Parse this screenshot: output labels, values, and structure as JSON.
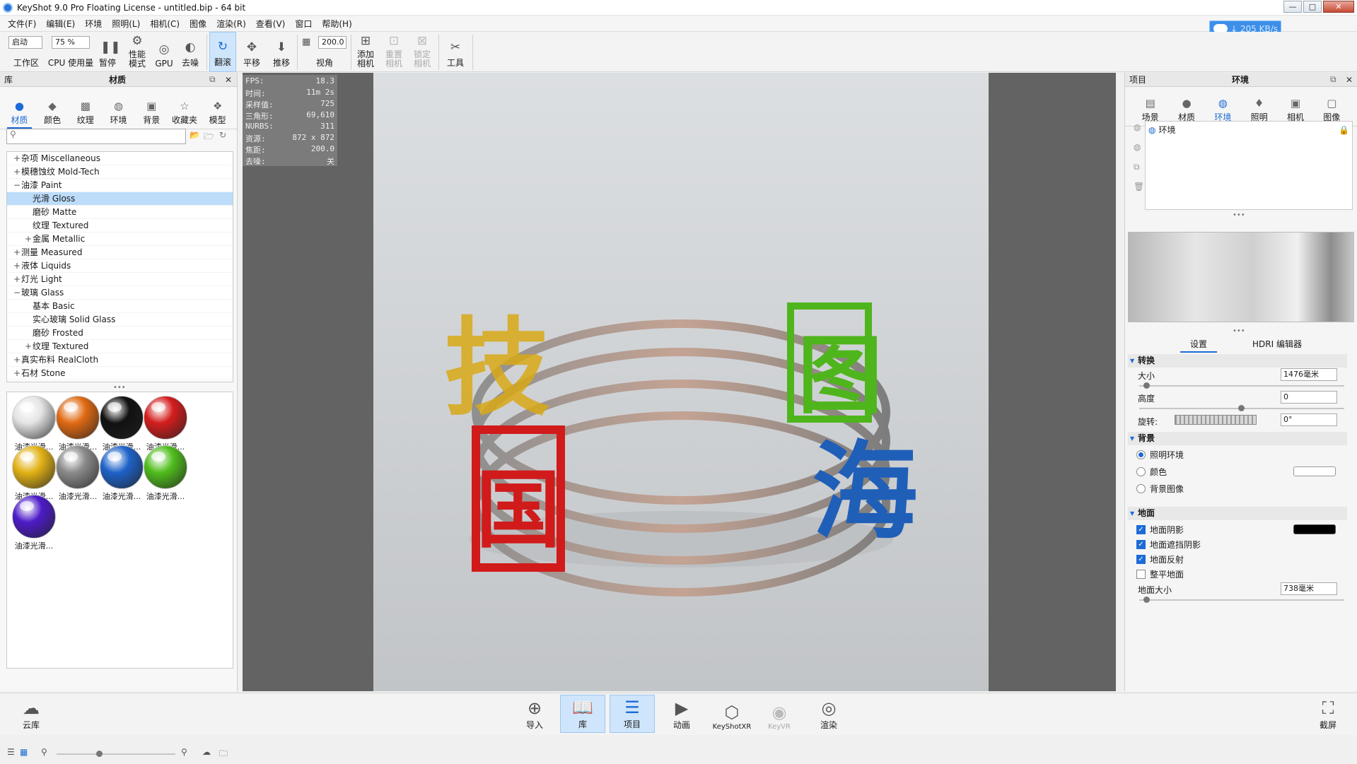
{
  "window": {
    "title": "KeyShot 9.0 Pro Floating License  - untitled.bip  - 64 bit",
    "controls": [
      "—",
      "□",
      "✕"
    ]
  },
  "menu": [
    "文件(F)",
    "编辑(E)",
    "环境",
    "照明(L)",
    "相机(C)",
    "图像",
    "渲染(R)",
    "查看(V)",
    "窗口",
    "帮助(H)"
  ],
  "network": {
    "speed": "↓ 205 KB/s"
  },
  "toolbar": {
    "workspace_value": "启动",
    "workspace_label": "工作区",
    "cpu_value": "75 %",
    "cpu_label": "CPU 使用量",
    "pause": "暂停",
    "perf": "性能\n模式",
    "gpu": "GPU",
    "denoise": "去噪",
    "tumble": "翻滚",
    "pan": "平移",
    "dolly": "推移",
    "fov_value": "200.0",
    "fov_label": "视角",
    "add_camera": "添加\n相机",
    "reset_camera": "重置\n相机",
    "lock_camera": "锁定\n相机",
    "tools": "工具"
  },
  "library": {
    "panel_label": "库",
    "panel_title": "材质",
    "tabs": [
      "材质",
      "颜色",
      "纹理",
      "环境",
      "背景",
      "收藏夹",
      "模型"
    ],
    "tree": [
      {
        "label": "杂项 Miscellaneous",
        "ex": "+",
        "indent": 0
      },
      {
        "label": "模穗蚀纹 Mold-Tech",
        "ex": "+",
        "indent": 0
      },
      {
        "label": "油漆 Paint",
        "ex": "−",
        "indent": 0
      },
      {
        "label": "光滑 Gloss",
        "ex": "",
        "indent": 1,
        "selected": true
      },
      {
        "label": "磨砂 Matte",
        "ex": "",
        "indent": 1
      },
      {
        "label": "纹理 Textured",
        "ex": "",
        "indent": 1
      },
      {
        "label": "金属 Metallic",
        "ex": "+",
        "indent": 1
      },
      {
        "label": "测量 Measured",
        "ex": "+",
        "indent": 0
      },
      {
        "label": "液体 Liquids",
        "ex": "+",
        "indent": 0
      },
      {
        "label": "灯光 Light",
        "ex": "+",
        "indent": 0
      },
      {
        "label": "玻璃 Glass",
        "ex": "−",
        "indent": 0
      },
      {
        "label": "基本 Basic",
        "ex": "",
        "indent": 1
      },
      {
        "label": "实心玻璃 Solid Glass",
        "ex": "",
        "indent": 1
      },
      {
        "label": "磨砂 Frosted",
        "ex": "",
        "indent": 1
      },
      {
        "label": "纹理 Textured",
        "ex": "+",
        "indent": 1
      },
      {
        "label": "真实布料 RealCloth",
        "ex": "+",
        "indent": 0
      },
      {
        "label": "石材 Stone",
        "ex": "+",
        "indent": 0
      }
    ],
    "thumbs": [
      {
        "label": "油漆光滑...",
        "color": "#e4e4e4"
      },
      {
        "label": "油漆光滑...",
        "color": "#e06a12"
      },
      {
        "label": "油漆光滑...",
        "color": "#111111"
      },
      {
        "label": "油漆光滑...",
        "color": "#d41d1d"
      },
      {
        "label": "油漆光滑...",
        "color": "#e2b216"
      },
      {
        "label": "油漆光滑...",
        "color": "#8a8a8a"
      },
      {
        "label": "油漆光滑...",
        "color": "#1e62c9"
      },
      {
        "label": "油漆光滑...",
        "color": "#4fbd1c"
      },
      {
        "label": "油漆光滑...",
        "color": "#4d1bc8"
      }
    ]
  },
  "stats": [
    {
      "k": "FPS:",
      "v": "18.3"
    },
    {
      "k": "时间:",
      "v": "11m 2s"
    },
    {
      "k": "采样值:",
      "v": "725"
    },
    {
      "k": "三角形:",
      "v": "69,610"
    },
    {
      "k": "NURBS:",
      "v": "311"
    },
    {
      "k": "资源:",
      "v": "872 x 872"
    },
    {
      "k": "焦距:",
      "v": "200.0"
    },
    {
      "k": "去噪:",
      "v": "关"
    }
  ],
  "render": {
    "chars": [
      "技",
      "图",
      "国",
      "海"
    ],
    "char_colors": [
      "#d9a917",
      "#4fb51c",
      "#d11a1a",
      "#1f5fb8"
    ]
  },
  "project": {
    "panel_label": "项目",
    "panel_title": "环境",
    "tabs": [
      "场景",
      "材质",
      "环境",
      "照明",
      "相机",
      "图像"
    ],
    "env_item": "环境",
    "subtabs": [
      "设置",
      "HDRI 编辑器"
    ],
    "transform": {
      "header": "转换",
      "size_label": "大小",
      "size_value": "1476毫米",
      "height_label": "高度",
      "height_value": "0",
      "rotation_label": "旋转:",
      "rotation_value": "0°"
    },
    "background": {
      "header": "背景",
      "options": [
        "照明环境",
        "颜色",
        "背景图像"
      ]
    },
    "ground": {
      "header": "地面",
      "shadow": "地面阴影",
      "occlusion": "地面遮挡阴影",
      "reflection": "地面反射",
      "flatten": "整平地面",
      "size_label": "地面大小",
      "size_value": "738毫米",
      "shadow_color": "#000000"
    }
  },
  "bottom": {
    "cloud": "云库",
    "import": "导入",
    "library": "库",
    "project": "项目",
    "animation": "动画",
    "xr": "KeyShotXR",
    "vr": "KeyVR",
    "render": "渲染",
    "screenshot": "截屏"
  }
}
